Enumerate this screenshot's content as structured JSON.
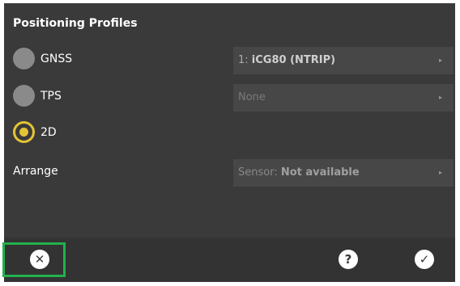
{
  "dialog": {
    "title": "Positioning Profiles"
  },
  "profiles": {
    "gnss": {
      "label": "GNSS",
      "selected": false,
      "dropdown_prefix": "1: ",
      "dropdown_value": "iCG80 (NTRIP)",
      "arrow": "▸"
    },
    "tps": {
      "label": "TPS",
      "selected": false,
      "dropdown_value": "None",
      "arrow": "▸"
    },
    "twod": {
      "label": "2D",
      "selected": true
    }
  },
  "arrange": {
    "label": "Arrange",
    "dropdown_prefix": "Sensor: ",
    "dropdown_value": "Not available",
    "arrow": "▸"
  },
  "footer": {
    "cancel_glyph": "✕",
    "help_glyph": "?",
    "ok_glyph": "✓"
  },
  "colors": {
    "background": "#3a3a3a",
    "accent": "#e3c436",
    "highlight": "#22b14c"
  },
  "icons": {
    "cancel": "close-icon",
    "help": "help-icon",
    "ok": "check-icon"
  }
}
